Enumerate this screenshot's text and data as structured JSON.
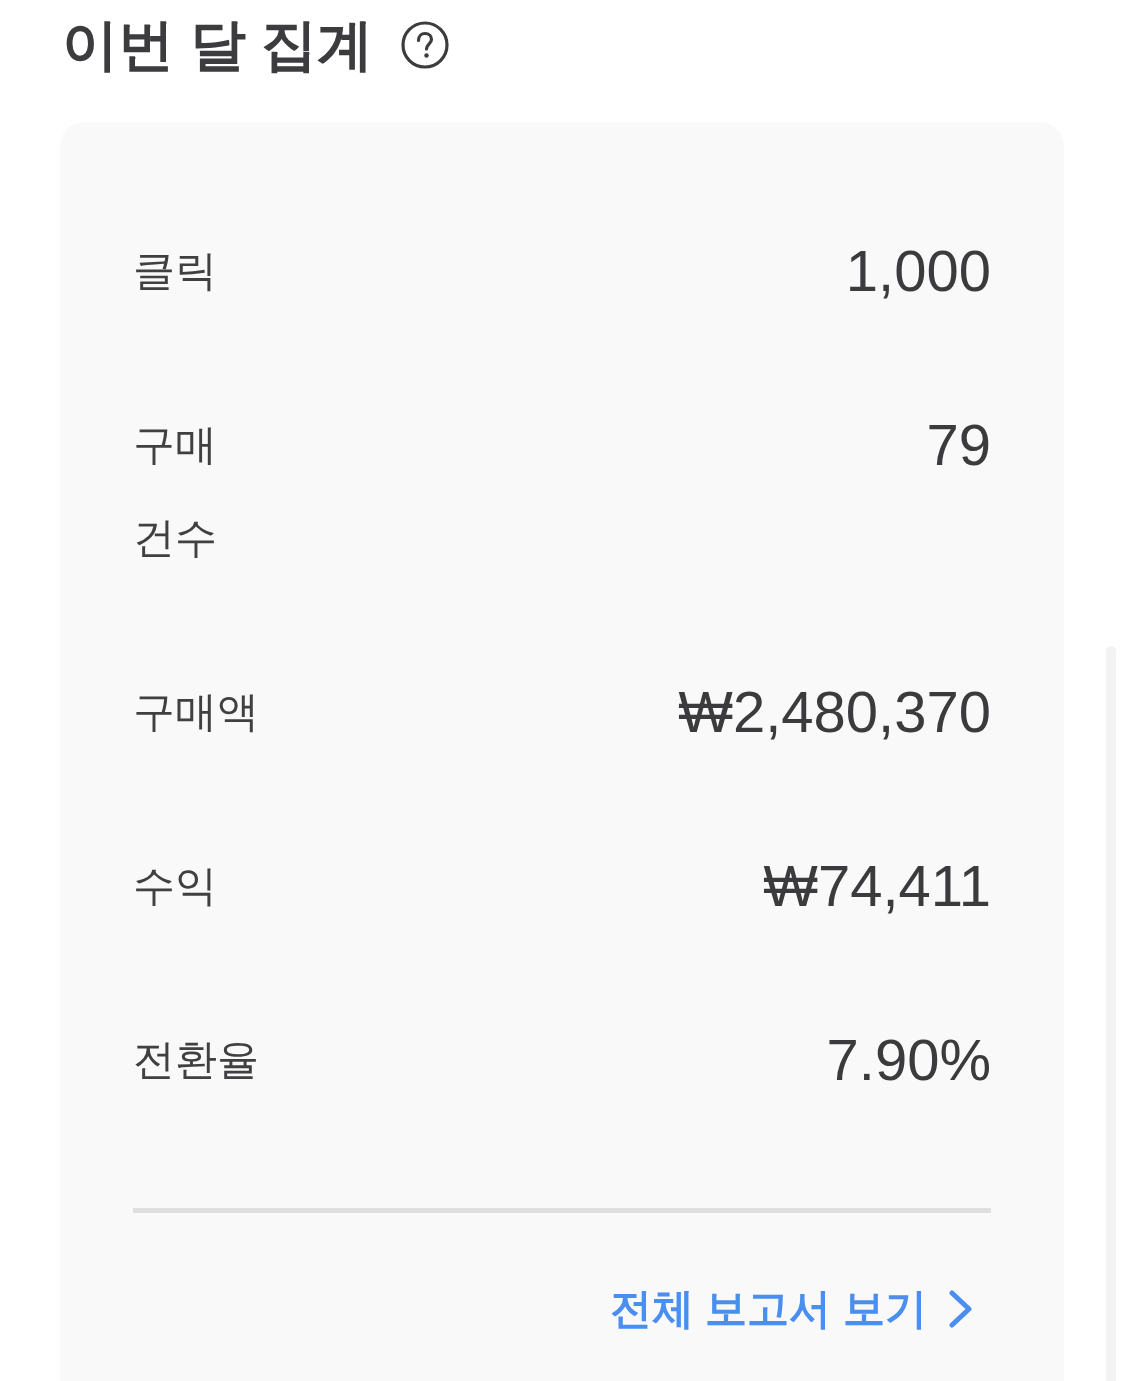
{
  "header": {
    "title": "이번 달 집계"
  },
  "summary": {
    "rows": [
      {
        "label": "클릭",
        "value": "1,000"
      },
      {
        "label": "구매 건수",
        "value": "79"
      },
      {
        "label": "구매액",
        "value": "₩2,480,370"
      },
      {
        "label": "수익",
        "value": "₩74,411"
      },
      {
        "label": "전환율",
        "value": "7.90%"
      }
    ],
    "link": {
      "label": "전체 보고서 보기"
    }
  }
}
